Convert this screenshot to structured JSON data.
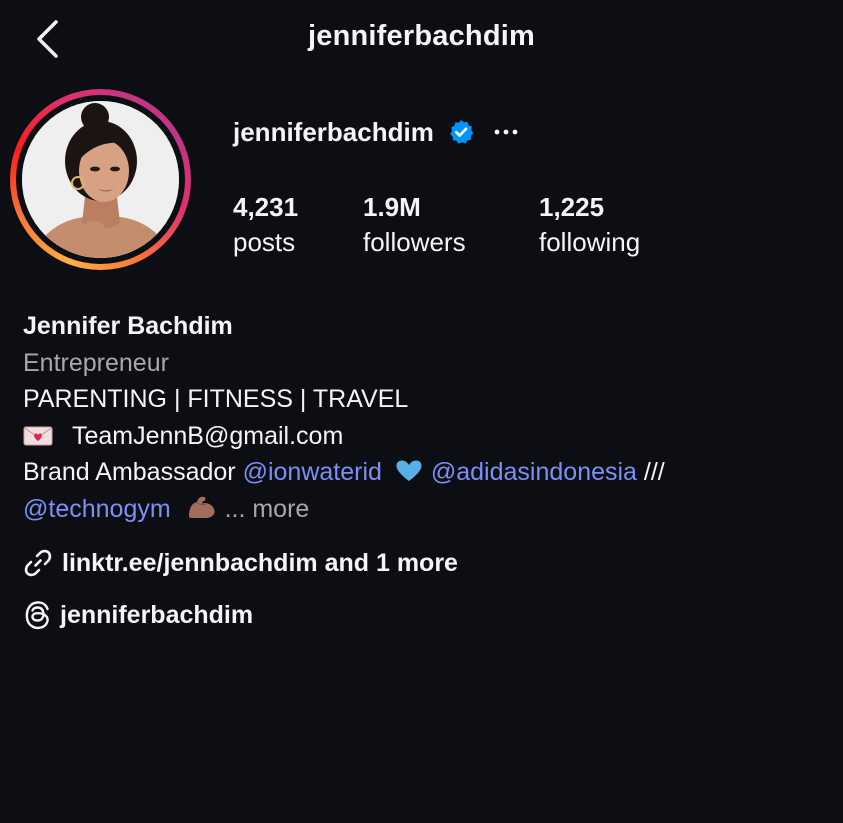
{
  "header": {
    "title": "jenniferbachdim"
  },
  "profile": {
    "username": "jenniferbachdim",
    "verified": true
  },
  "stats": {
    "posts": {
      "value": "4,231",
      "label": "posts"
    },
    "followers": {
      "value": "1.9M",
      "label": "followers"
    },
    "following": {
      "value": "1,225",
      "label": "following"
    }
  },
  "bio": {
    "name": "Jennifer Bachdim",
    "category": "Entrepreneur",
    "line1": "PARENTING | FITNESS | TRAVEL",
    "email": "TeamJennB@gmail.com",
    "ambassador_prefix": "Brand Ambassador ",
    "mention1": "@ionwaterid",
    "mention2": "@adidasindonesia",
    "separator": " ///",
    "mention3": "@technogym",
    "ellipsis": "... more"
  },
  "links": {
    "link_text": "linktr.ee/jennbachdim and 1 more",
    "threads_text": "jenniferbachdim"
  },
  "icons": {
    "back": "chevron-left-icon",
    "verified": "verified-badge-icon",
    "more": "more-options-icon",
    "envelope": "love-letter-emoji",
    "heart": "blue-heart-emoji",
    "muscle": "flexed-biceps-emoji",
    "link": "link-icon",
    "threads": "threads-icon"
  },
  "colors": {
    "background": "#0c0e14",
    "mention": "#7c8ff5",
    "secondary_text": "#a8a8a8",
    "verified": "#0095f6"
  }
}
